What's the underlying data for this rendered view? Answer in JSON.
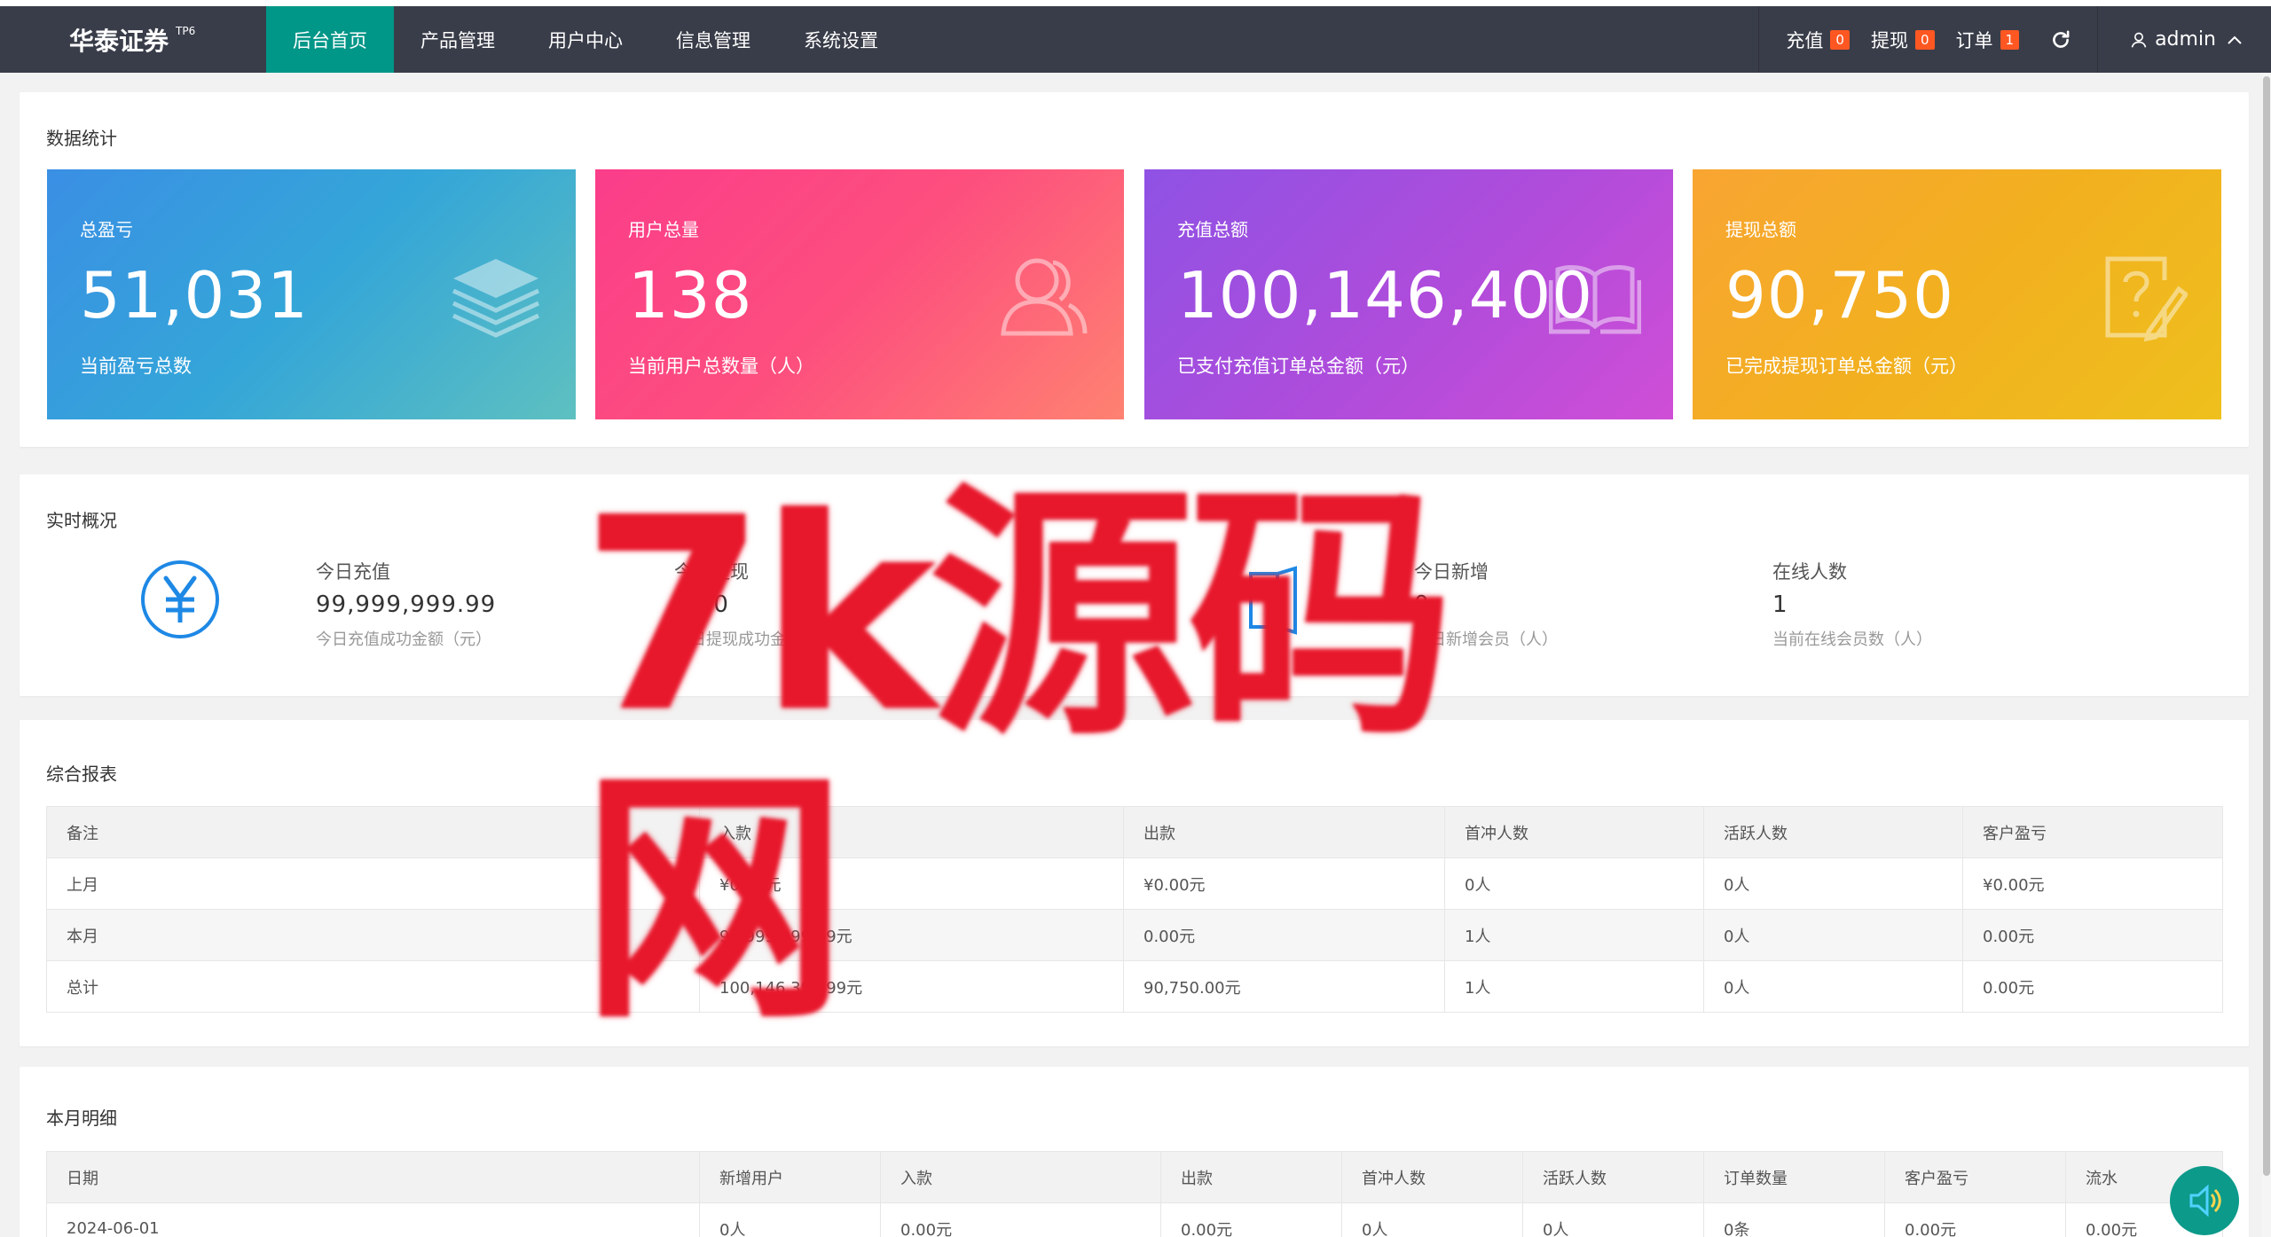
{
  "header": {
    "logo": "华泰证券",
    "logo_sup": "TP6",
    "nav": [
      "后台首页",
      "产品管理",
      "用户中心",
      "信息管理",
      "系统设置"
    ],
    "recharge_label": "充值",
    "recharge_count": "0",
    "withdraw_label": "提现",
    "withdraw_count": "0",
    "order_label": "订单",
    "order_count": "1",
    "user": "admin"
  },
  "stats": {
    "title": "数据统计",
    "tiles": [
      {
        "label": "总盈亏",
        "value": "51,031",
        "desc": "当前盈亏总数",
        "icon": "layers-icon"
      },
      {
        "label": "用户总量",
        "value": "138",
        "desc": "当前用户总数量（人）",
        "icon": "users-icon"
      },
      {
        "label": "充值总额",
        "value": "100,146,400",
        "desc": "已支付充值订单总金额（元）",
        "icon": "book-icon"
      },
      {
        "label": "提现总额",
        "value": "90,750",
        "desc": "已完成提现订单总金额（元）",
        "icon": "question-edit-icon"
      }
    ]
  },
  "realtime": {
    "title": "实时概况",
    "items": [
      {
        "label": "今日充值",
        "value": "99,999,999.99",
        "desc": "今日充值成功金额（元）"
      },
      {
        "label": "今日提现",
        "value": "0.00",
        "desc": "今日提现成功金额（元）"
      },
      {
        "label": "今日新增",
        "value": "0",
        "desc": "今日新增会员（人）"
      },
      {
        "label": "在线人数",
        "value": "1",
        "desc": "当前在线会员数（人）"
      }
    ]
  },
  "report": {
    "title": "综合报表",
    "columns": [
      "备注",
      "入款",
      "出款",
      "首冲人数",
      "活跃人数",
      "客户盈亏"
    ],
    "rows": [
      [
        "上月",
        "¥0.00元",
        "¥0.00元",
        "0人",
        "0人",
        "¥0.00元"
      ],
      [
        "本月",
        "99,999,999.99元",
        "0.00元",
        "1人",
        "0人",
        "0.00元"
      ],
      [
        "总计",
        "100,146,399.99元",
        "90,750.00元",
        "1人",
        "0人",
        "0.00元"
      ]
    ]
  },
  "monthly": {
    "title": "本月明细",
    "columns": [
      "日期",
      "新增用户",
      "入款",
      "出款",
      "首冲人数",
      "活跃人数",
      "订单数量",
      "客户盈亏",
      "流水"
    ],
    "rows": [
      [
        "2024-06-01",
        "0人",
        "0.00元",
        "0.00元",
        "0人",
        "0人",
        "0条",
        "0.00元",
        "0.00元"
      ]
    ]
  },
  "watermark": "7k源码网"
}
